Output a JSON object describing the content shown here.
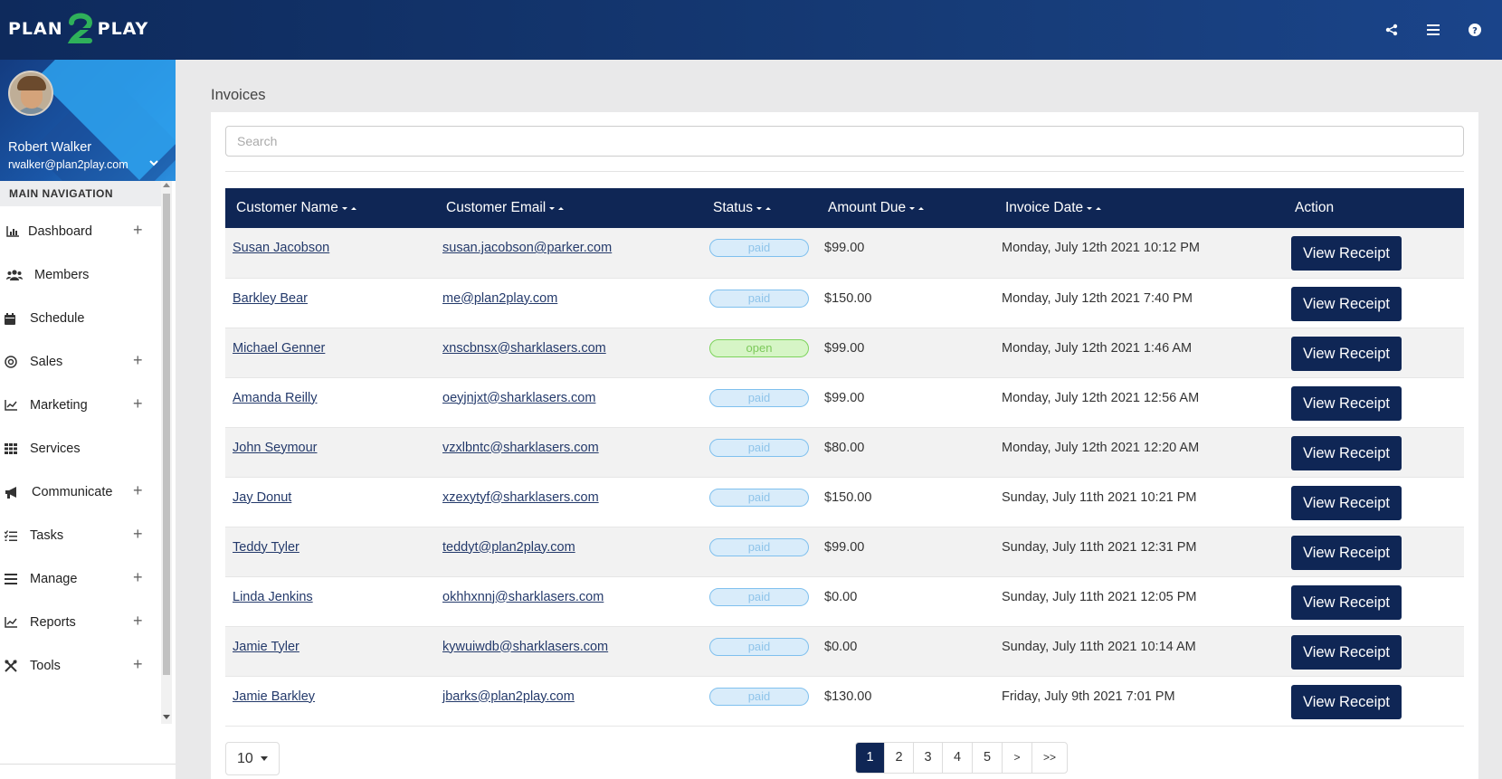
{
  "app": {
    "logo_left": "PLAN",
    "logo_right": "PLAY"
  },
  "user": {
    "name": "Robert Walker",
    "email": "rwalker@plan2play.com"
  },
  "nav": {
    "title": "MAIN NAVIGATION",
    "items": [
      {
        "label": "Dashboard",
        "icon": "chart-icon",
        "expandable": true
      },
      {
        "label": "Members",
        "icon": "users-icon",
        "expandable": false
      },
      {
        "label": "Schedule",
        "icon": "calendar-icon",
        "expandable": false
      },
      {
        "label": "Sales",
        "icon": "target-icon",
        "expandable": true
      },
      {
        "label": "Marketing",
        "icon": "line-chart-icon",
        "expandable": true
      },
      {
        "label": "Services",
        "icon": "grid-icon",
        "expandable": false
      },
      {
        "label": "Communicate",
        "icon": "megaphone-icon",
        "expandable": true
      },
      {
        "label": "Tasks",
        "icon": "tasks-icon",
        "expandable": true
      },
      {
        "label": "Manage",
        "icon": "bars-icon",
        "expandable": true
      },
      {
        "label": "Reports",
        "icon": "line-chart-icon",
        "expandable": true
      },
      {
        "label": "Tools",
        "icon": "tools-icon",
        "expandable": true
      }
    ],
    "plus": "+"
  },
  "page": {
    "title": "Invoices"
  },
  "search": {
    "placeholder": "Search"
  },
  "table": {
    "headers": [
      "Customer Name",
      "Customer Email",
      "Status",
      "Amount Due",
      "Invoice Date",
      "Action"
    ],
    "rows": [
      {
        "name": "Susan Jacobson",
        "email": "susan.jacobson@parker.com",
        "status": "paid",
        "amount": "$99.00",
        "date": "Monday, July 12th 2021 10:12 PM"
      },
      {
        "name": "Barkley Bear",
        "email": "me@plan2play.com",
        "status": "paid",
        "amount": "$150.00",
        "date": "Monday, July 12th 2021 7:40 PM"
      },
      {
        "name": "Michael Genner",
        "email": "xnscbnsx@sharklasers.com",
        "status": "open",
        "amount": "$99.00",
        "date": "Monday, July 12th 2021 1:46 AM"
      },
      {
        "name": "Amanda Reilly",
        "email": "oeyjnjxt@sharklasers.com",
        "status": "paid",
        "amount": "$99.00",
        "date": "Monday, July 12th 2021 12:56 AM"
      },
      {
        "name": "John Seymour",
        "email": "vzxlbntc@sharklasers.com",
        "status": "paid",
        "amount": "$80.00",
        "date": "Monday, July 12th 2021 12:20 AM"
      },
      {
        "name": "Jay Donut",
        "email": "xzexytyf@sharklasers.com",
        "status": "paid",
        "amount": "$150.00",
        "date": "Sunday, July 11th 2021 10:21 PM"
      },
      {
        "name": "Teddy Tyler",
        "email": "teddyt@plan2play.com",
        "status": "paid",
        "amount": "$99.00",
        "date": "Sunday, July 11th 2021 12:31 PM"
      },
      {
        "name": "Linda Jenkins",
        "email": "okhhxnnj@sharklasers.com",
        "status": "paid",
        "amount": "$0.00",
        "date": "Sunday, July 11th 2021 12:05 PM"
      },
      {
        "name": "Jamie Tyler",
        "email": "kywuiwdb@sharklasers.com",
        "status": "paid",
        "amount": "$0.00",
        "date": "Sunday, July 11th 2021 10:14 AM"
      },
      {
        "name": "Jamie Barkley",
        "email": "jbarks@plan2play.com",
        "status": "paid",
        "amount": "$130.00",
        "date": "Friday, July 9th 2021 7:01 PM"
      }
    ],
    "action_label": "View Receipt"
  },
  "pagination": {
    "per_page": "10",
    "pages": [
      "1",
      "2",
      "3",
      "4",
      "5",
      ">",
      ">>"
    ],
    "active": "1"
  },
  "colors": {
    "primary": "#0f2655",
    "paid": "#d9ecfa",
    "open": "#d6f5c6"
  }
}
